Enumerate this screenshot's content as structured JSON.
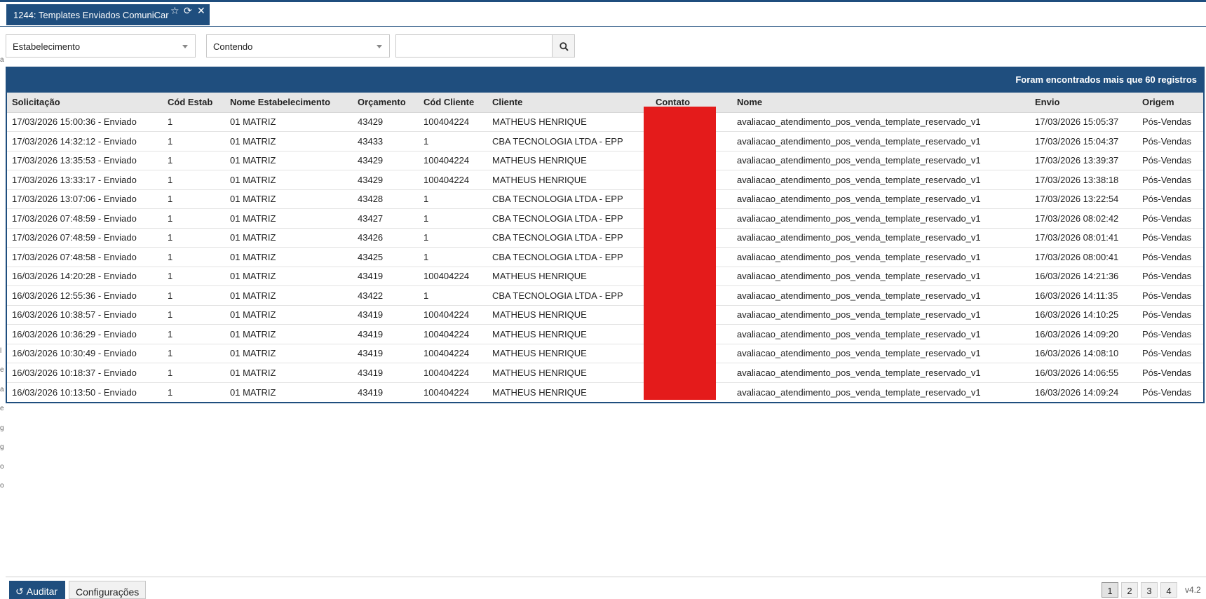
{
  "tab": {
    "title": "1244: Templates Enviados ComuniCar",
    "icons": [
      "star-icon",
      "refresh-icon",
      "close-icon"
    ]
  },
  "filters": {
    "field_select": "Estabelecimento",
    "operator_select": "Contendo",
    "search_value": ""
  },
  "grid": {
    "count_text": "Foram encontrados mais que 60 registros",
    "columns": [
      "Solicitação",
      "Cód Estab",
      "Nome Estabelecimento",
      "Orçamento",
      "Cód Cliente",
      "Cliente",
      "Contato",
      "Nome",
      "Envio",
      "Origem"
    ],
    "rows": [
      [
        "17/03/2026 15:00:36 - Enviado",
        "1",
        "01 MATRIZ",
        "43429",
        "100404224",
        "MATHEUS HENRIQUE",
        "",
        "avaliacao_atendimento_pos_venda_template_reservado_v1",
        "17/03/2026 15:05:37",
        "Pós-Vendas"
      ],
      [
        "17/03/2026 14:32:12 - Enviado",
        "1",
        "01 MATRIZ",
        "43433",
        "1",
        "CBA TECNOLOGIA LTDA - EPP",
        "",
        "avaliacao_atendimento_pos_venda_template_reservado_v1",
        "17/03/2026 15:04:37",
        "Pós-Vendas"
      ],
      [
        "17/03/2026 13:35:53 - Enviado",
        "1",
        "01 MATRIZ",
        "43429",
        "100404224",
        "MATHEUS HENRIQUE",
        "",
        "avaliacao_atendimento_pos_venda_template_reservado_v1",
        "17/03/2026 13:39:37",
        "Pós-Vendas"
      ],
      [
        "17/03/2026 13:33:17 - Enviado",
        "1",
        "01 MATRIZ",
        "43429",
        "100404224",
        "MATHEUS HENRIQUE",
        "",
        "avaliacao_atendimento_pos_venda_template_reservado_v1",
        "17/03/2026 13:38:18",
        "Pós-Vendas"
      ],
      [
        "17/03/2026 13:07:06 - Enviado",
        "1",
        "01 MATRIZ",
        "43428",
        "1",
        "CBA TECNOLOGIA LTDA - EPP",
        "",
        "avaliacao_atendimento_pos_venda_template_reservado_v1",
        "17/03/2026 13:22:54",
        "Pós-Vendas"
      ],
      [
        "17/03/2026 07:48:59 - Enviado",
        "1",
        "01 MATRIZ",
        "43427",
        "1",
        "CBA TECNOLOGIA LTDA - EPP",
        "",
        "avaliacao_atendimento_pos_venda_template_reservado_v1",
        "17/03/2026 08:02:42",
        "Pós-Vendas"
      ],
      [
        "17/03/2026 07:48:59 - Enviado",
        "1",
        "01 MATRIZ",
        "43426",
        "1",
        "CBA TECNOLOGIA LTDA - EPP",
        "",
        "avaliacao_atendimento_pos_venda_template_reservado_v1",
        "17/03/2026 08:01:41",
        "Pós-Vendas"
      ],
      [
        "17/03/2026 07:48:58 - Enviado",
        "1",
        "01 MATRIZ",
        "43425",
        "1",
        "CBA TECNOLOGIA LTDA - EPP",
        "",
        "avaliacao_atendimento_pos_venda_template_reservado_v1",
        "17/03/2026 08:00:41",
        "Pós-Vendas"
      ],
      [
        "16/03/2026 14:20:28 - Enviado",
        "1",
        "01 MATRIZ",
        "43419",
        "100404224",
        "MATHEUS HENRIQUE",
        "",
        "avaliacao_atendimento_pos_venda_template_reservado_v1",
        "16/03/2026 14:21:36",
        "Pós-Vendas"
      ],
      [
        "16/03/2026 12:55:36 - Enviado",
        "1",
        "01 MATRIZ",
        "43422",
        "1",
        "CBA TECNOLOGIA LTDA - EPP",
        "",
        "avaliacao_atendimento_pos_venda_template_reservado_v1",
        "16/03/2026 14:11:35",
        "Pós-Vendas"
      ],
      [
        "16/03/2026 10:38:57 - Enviado",
        "1",
        "01 MATRIZ",
        "43419",
        "100404224",
        "MATHEUS HENRIQUE",
        "",
        "avaliacao_atendimento_pos_venda_template_reservado_v1",
        "16/03/2026 14:10:25",
        "Pós-Vendas"
      ],
      [
        "16/03/2026 10:36:29 - Enviado",
        "1",
        "01 MATRIZ",
        "43419",
        "100404224",
        "MATHEUS HENRIQUE",
        "",
        "avaliacao_atendimento_pos_venda_template_reservado_v1",
        "16/03/2026 14:09:20",
        "Pós-Vendas"
      ],
      [
        "16/03/2026 10:30:49 - Enviado",
        "1",
        "01 MATRIZ",
        "43419",
        "100404224",
        "MATHEUS HENRIQUE",
        "",
        "avaliacao_atendimento_pos_venda_template_reservado_v1",
        "16/03/2026 14:08:10",
        "Pós-Vendas"
      ],
      [
        "16/03/2026 10:18:37 - Enviado",
        "1",
        "01 MATRIZ",
        "43419",
        "100404224",
        "MATHEUS HENRIQUE",
        "",
        "avaliacao_atendimento_pos_venda_template_reservado_v1",
        "16/03/2026 14:06:55",
        "Pós-Vendas"
      ],
      [
        "16/03/2026 10:13:50 - Enviado",
        "1",
        "01 MATRIZ",
        "43419",
        "100404224",
        "MATHEUS HENRIQUE",
        "",
        "avaliacao_atendimento_pos_venda_template_reservado_v1",
        "16/03/2026 14:09:24",
        "Pós-Vendas"
      ]
    ],
    "redacted_column": "Contato",
    "redaction_color": "#e41b1b"
  },
  "footer": {
    "auditar_label": "Auditar",
    "config_label": "Configurações",
    "pages": [
      "1",
      "2",
      "3",
      "4"
    ],
    "active_page": "1",
    "version": "v4.2"
  },
  "left_marks": [
    "a",
    "l",
    "e",
    "a",
    "e",
    "g",
    "g",
    "o",
    "o"
  ],
  "colors": {
    "accent": "#1f4e7e",
    "header_bg": "#e7e7e7"
  }
}
